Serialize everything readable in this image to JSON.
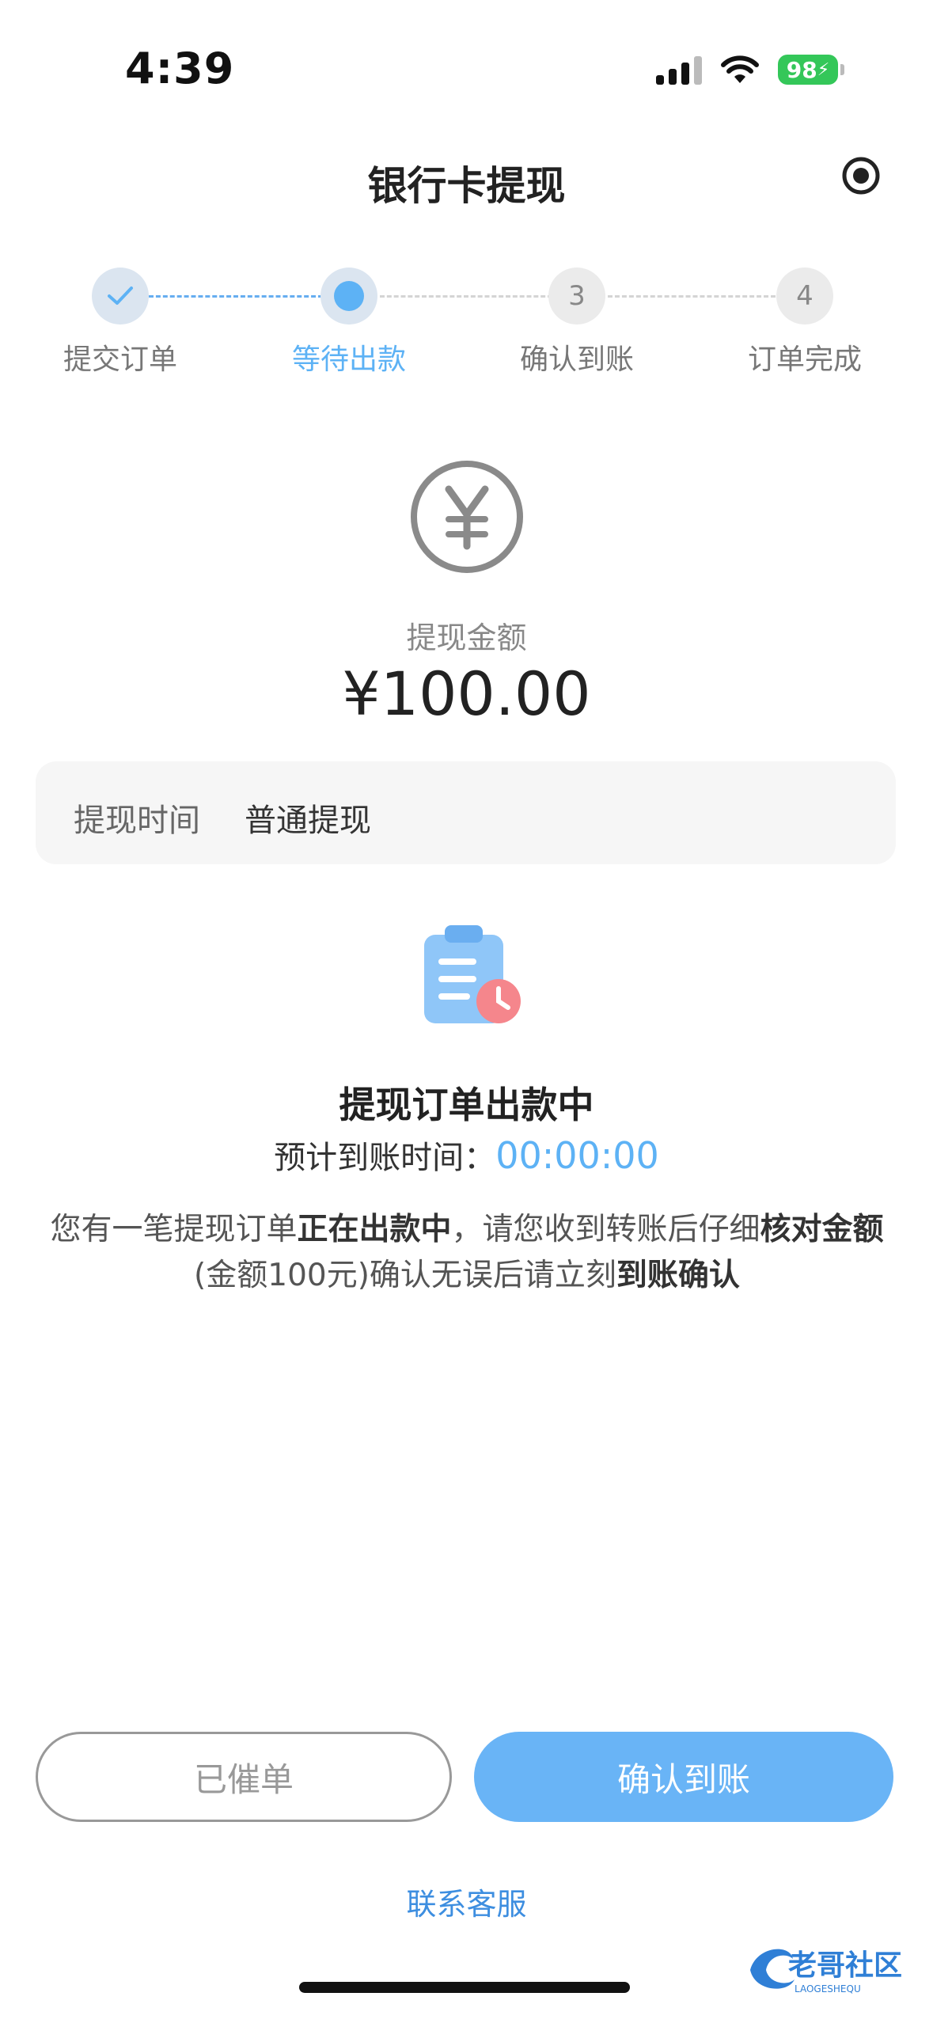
{
  "status_bar": {
    "time": "4:39",
    "battery": "98"
  },
  "header": {
    "title": "银行卡提现",
    "record_icon": "record-icon"
  },
  "steps": [
    {
      "label": "提交订单",
      "marker": "✓",
      "state": "done"
    },
    {
      "label": "等待出款",
      "marker": "",
      "state": "current"
    },
    {
      "label": "确认到账",
      "marker": "3",
      "state": "pending"
    },
    {
      "label": "订单完成",
      "marker": "4",
      "state": "pending"
    }
  ],
  "amount": {
    "label": "提现金额",
    "value": "¥100.00",
    "icon": "yuan-icon"
  },
  "info": {
    "label": "提现时间",
    "value": "普通提现"
  },
  "status": {
    "title": "提现订单出款中",
    "eta_label": "预计到账时间：",
    "eta_value": "00:00:00",
    "desc_parts": [
      "您有一笔提现订单",
      "正在出款中",
      "，请您收到转账后仔细",
      "核对金额",
      "(金额100元)确认无误后请立刻",
      "到账确认"
    ]
  },
  "buttons": {
    "urge": "已催单",
    "confirm": "确认到账"
  },
  "contact": "联系客服",
  "watermark": {
    "text": "老哥社区",
    "sub": "LAOGESHEQU"
  },
  "colors": {
    "accent": "#5db2f5",
    "button_blue": "#69b4f6",
    "link": "#3d8ee0",
    "battery": "#34c759"
  }
}
